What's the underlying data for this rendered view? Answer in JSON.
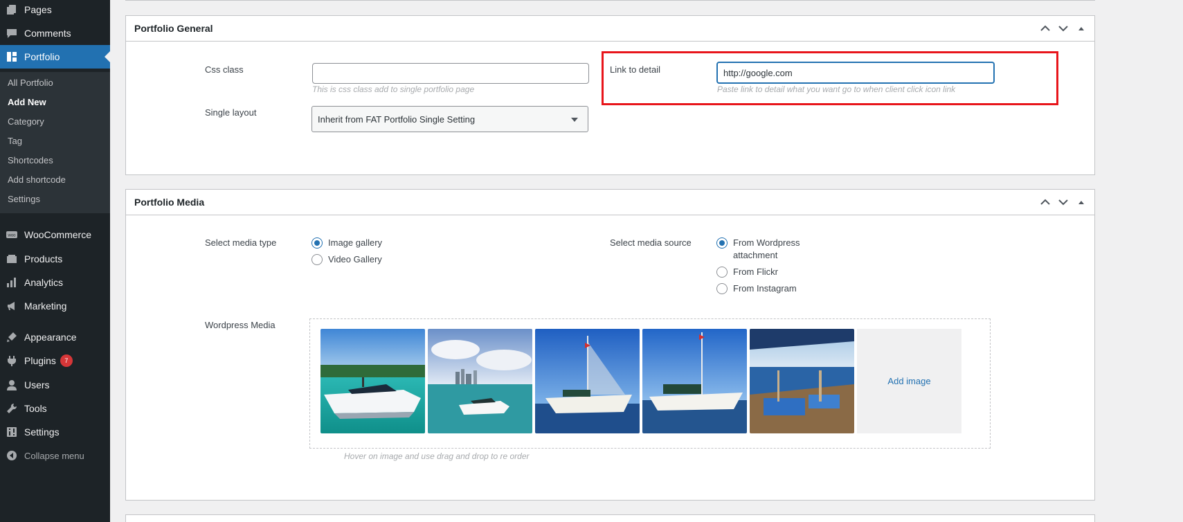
{
  "sidebar": {
    "items": [
      {
        "label": "Pages",
        "icon": "pages-icon"
      },
      {
        "label": "Comments",
        "icon": "comments-icon"
      },
      {
        "label": "Portfolio",
        "icon": "portfolio-icon"
      },
      {
        "label": "WooCommerce",
        "icon": "woocommerce-icon"
      },
      {
        "label": "Products",
        "icon": "products-icon"
      },
      {
        "label": "Analytics",
        "icon": "analytics-icon"
      },
      {
        "label": "Marketing",
        "icon": "marketing-icon"
      },
      {
        "label": "Appearance",
        "icon": "appearance-icon"
      },
      {
        "label": "Plugins",
        "icon": "plugins-icon",
        "badge": "7"
      },
      {
        "label": "Users",
        "icon": "users-icon"
      },
      {
        "label": "Tools",
        "icon": "tools-icon"
      },
      {
        "label": "Settings",
        "icon": "settings-icon"
      }
    ],
    "submenu": [
      "All Portfolio",
      "Add New",
      "Category",
      "Tag",
      "Shortcodes",
      "Add shortcode",
      "Settings"
    ],
    "collapse_label": "Collapse menu"
  },
  "general": {
    "title": "Portfolio General",
    "css_class_label": "Css class",
    "css_class_value": "",
    "css_class_hint": "This is css class add to single portfolio page",
    "single_layout_label": "Single layout",
    "single_layout_value": "Inherit from FAT Portfolio Single Setting",
    "link_label": "Link to detail",
    "link_value": "http://google.com",
    "link_hint": "Paste link to detail what you want go to when client click icon link"
  },
  "media": {
    "title": "Portfolio Media",
    "media_type_label": "Select media type",
    "media_types": [
      "Image gallery",
      "Video Gallery"
    ],
    "media_type_selected": "Image gallery",
    "media_source_label": "Select media source",
    "media_sources": [
      "From Wordpress attachment",
      "From Flickr",
      "From Instagram"
    ],
    "media_source_selected": "From Wordpress attachment",
    "wp_media_label": "Wordpress Media",
    "add_image_label": "Add image",
    "reorder_hint": "Hover on image and use drag and drop to re order"
  },
  "colors": {
    "sidebar_bg": "#1d2327",
    "accent": "#2271b1",
    "highlight": "#e8151b"
  }
}
